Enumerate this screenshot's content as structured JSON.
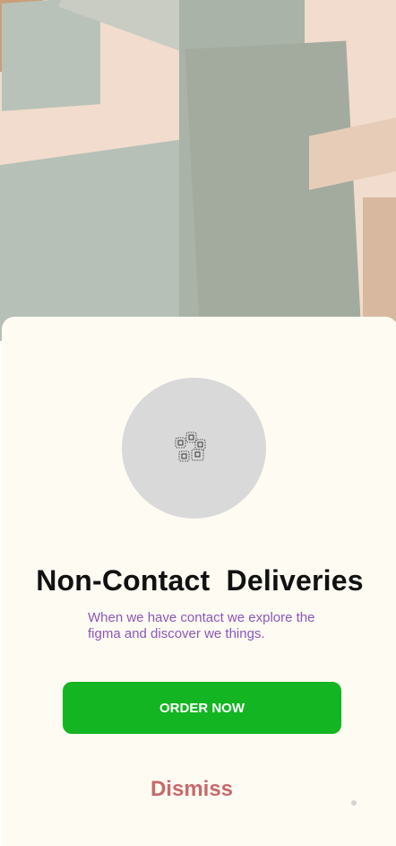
{
  "onboarding": {
    "title": "Non-Contact  Deliveries",
    "subtitle": "When we have contact we explore the figma and discover we things.",
    "primary_button": "ORDER NOW",
    "secondary_button": "Dismiss"
  },
  "icons": {
    "avatar": "image-placeholder-icon"
  },
  "colors": {
    "card_bg": "#fefbf3",
    "primary": "#13b522",
    "subtitle": "#8a57b8",
    "dismiss": "#c66a6a",
    "avatar_bg": "#d9d9d9"
  }
}
